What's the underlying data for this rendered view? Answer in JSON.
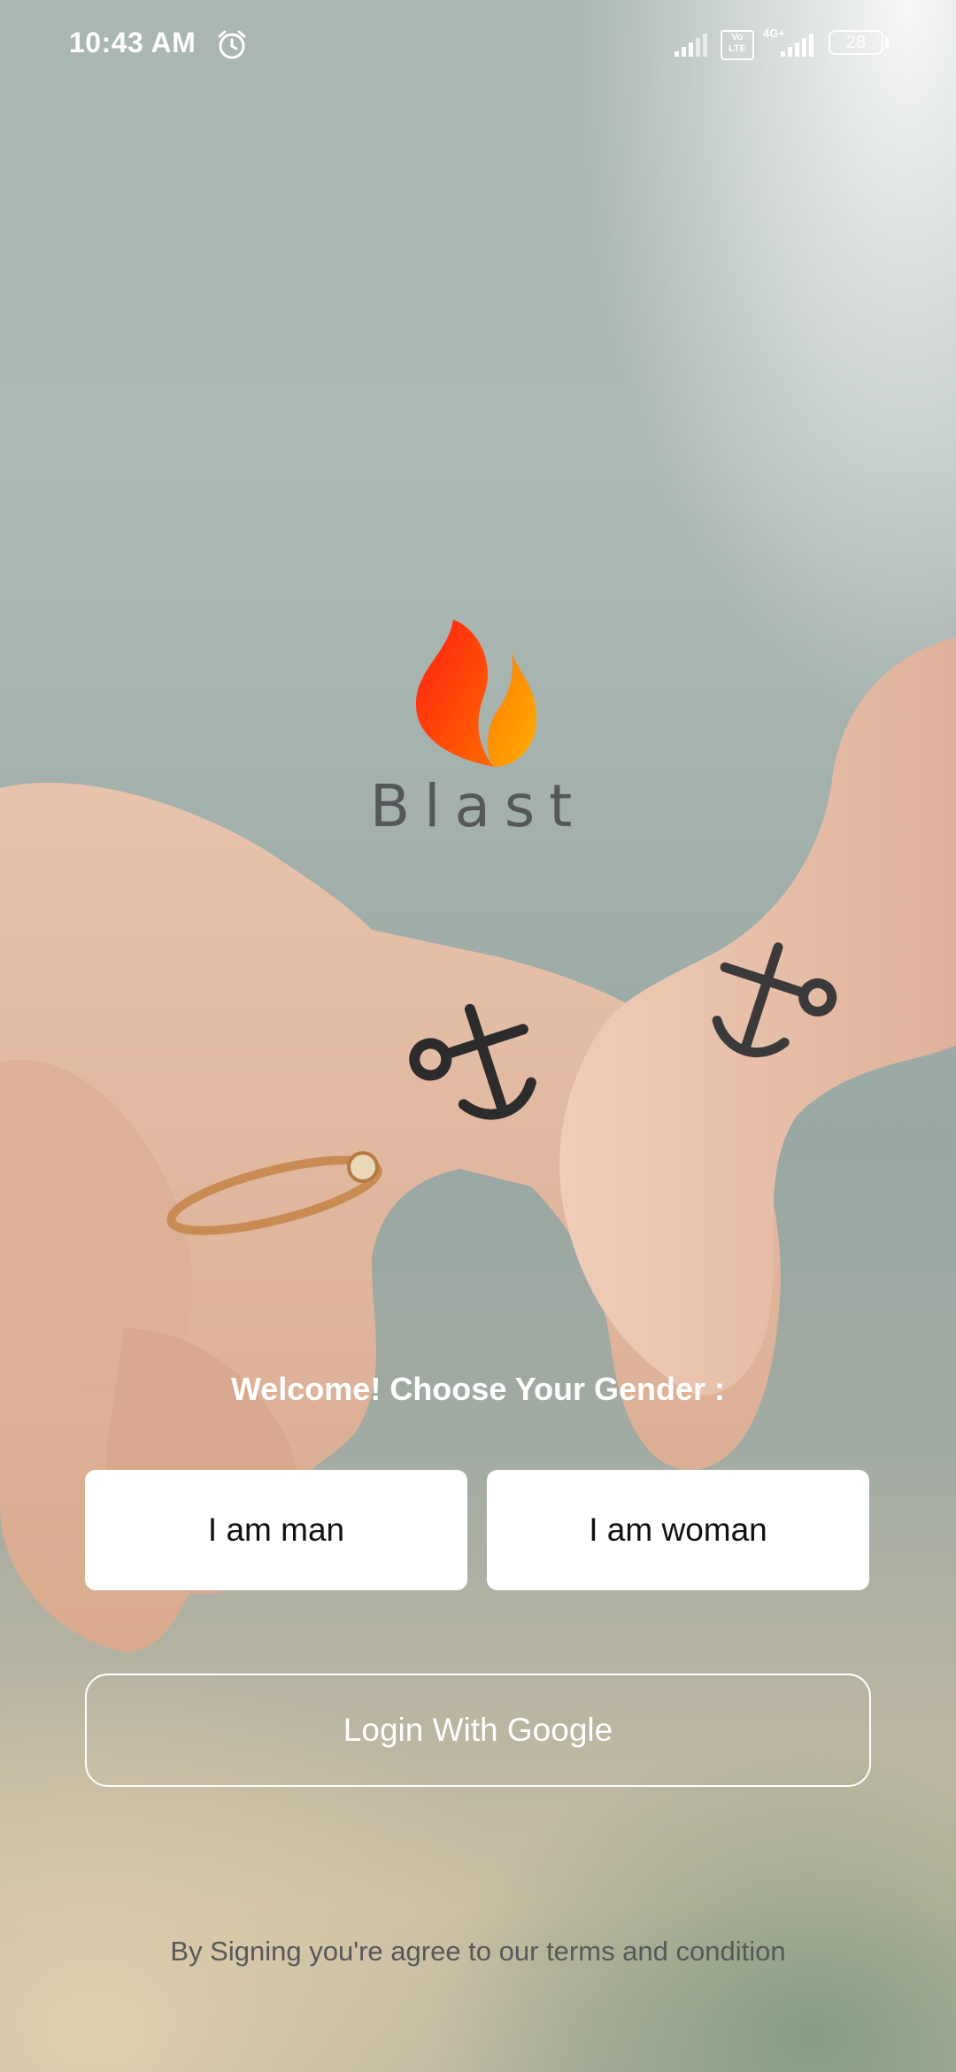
{
  "status_bar": {
    "time": "10:43 AM",
    "volte": "Vo LTE",
    "network_type": "4G+",
    "battery": "28",
    "icons": [
      "alarm-icon",
      "signal-icon",
      "signal-icon"
    ]
  },
  "app": {
    "name": "Blast",
    "logo_colors": [
      "#ff2a0e",
      "#ff7a00",
      "#ffa800"
    ]
  },
  "welcome": {
    "prompt": "Welcome! Choose Your Gender :"
  },
  "buttons": {
    "man_label": "I am man",
    "woman_label": "I am woman",
    "google_label": "Login With Google"
  },
  "footer": {
    "terms": "By Signing you're agree to our terms and condition"
  }
}
